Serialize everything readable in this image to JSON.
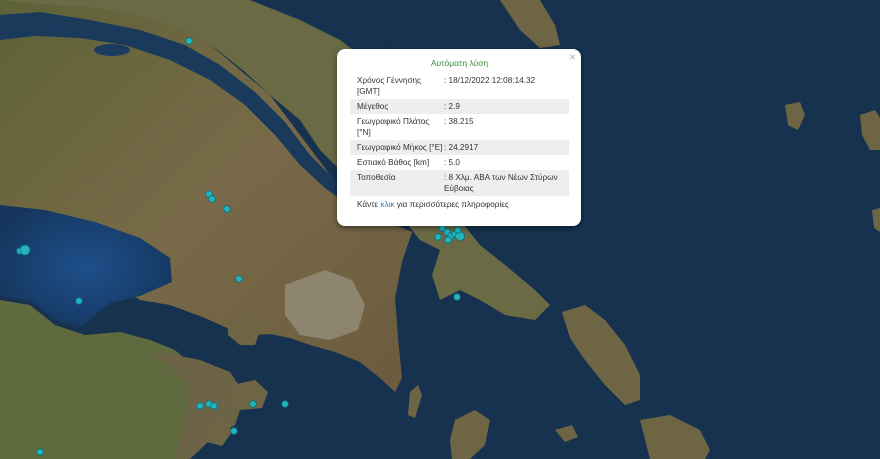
{
  "popup": {
    "title": "Αυτόματη λύση",
    "close": "×",
    "rows": [
      {
        "label": "Χρόνος Γέννησης [GMT]",
        "value": ": 18/12/2022 12:08:14.32"
      },
      {
        "label": "Μέγεθος",
        "value": ": 2.9"
      },
      {
        "label": "Γεωγραφικό Πλάτος [°N]",
        "value": ": 38.215"
      },
      {
        "label": "Γεωγραφικό Μήκος [°E]",
        "value": ": 24.2917"
      },
      {
        "label": "Εστιακό Βάθος [km]",
        "value": ": 5.0"
      },
      {
        "label": "Τοποθεσία",
        "value": ": 8 Χλμ. ΑΒΑ των Νέων Στύρων Εύβοιας"
      }
    ],
    "more_prefix": "Κάντε ",
    "more_link": "κλικ",
    "more_suffix": " για περισσότερες πληροφορίες"
  },
  "map": {
    "colors": {
      "sea": "#17324f",
      "land": "#6a6240",
      "marker": "#22b5bf",
      "marker_stroke": "#0f6f78"
    },
    "markers_count": 24
  }
}
